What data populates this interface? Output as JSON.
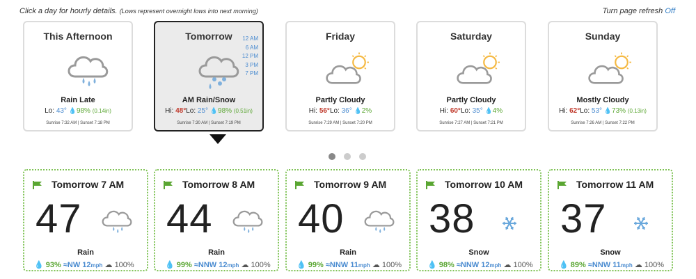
{
  "header": {
    "hint": "Click a day for hourly details.",
    "hint_note": "(Lows represent overnight lows into next morning)",
    "refresh_label": "Turn page refresh",
    "refresh_value": "Off"
  },
  "days": [
    {
      "title": "This Afternoon",
      "icon": "rain-cloud-icon",
      "cond": "Rain Late",
      "hi": "",
      "lo": "43°",
      "pop": "98%",
      "amt": "(0.14in)",
      "sun": "Sunrise 7:32 AM | Sunset 7:18 PM"
    },
    {
      "title": "Tomorrow",
      "icon": "rain-snow-cloud-icon",
      "cond": "AM Rain/Snow",
      "hi": "48°",
      "lo": "25°",
      "pop": "98%",
      "amt": "(0.51in)",
      "sun": "Sunrise 7:30 AM | Sunset 7:19 PM",
      "hours": [
        "12 AM",
        "6 AM",
        "12 PM",
        "3 PM",
        "7 PM"
      ]
    },
    {
      "title": "Friday",
      "icon": "partly-cloudy-icon",
      "cond": "Partly Cloudy",
      "hi": "56°",
      "lo": "36°",
      "pop": "2%",
      "amt": "",
      "sun": "Sunrise 7:29 AM | Sunset 7:20 PM"
    },
    {
      "title": "Saturday",
      "icon": "partly-cloudy-icon",
      "cond": "Partly Cloudy",
      "hi": "60°",
      "lo": "35°",
      "pop": "4%",
      "amt": "",
      "sun": "Sunrise 7:27 AM | Sunset 7:21 PM"
    },
    {
      "title": "Sunday",
      "icon": "mostly-cloudy-icon",
      "cond": "Mostly Cloudy",
      "hi": "62°",
      "lo": "53°",
      "pop": "73%",
      "amt": "(0.13in)",
      "sun": "Sunrise 7:26 AM | Sunset 7:22 PM"
    }
  ],
  "labels": {
    "hi": "Hi:",
    "lo": "Lo:"
  },
  "pager": {
    "count": 3,
    "active": 0
  },
  "hours": [
    {
      "title": "Tomorrow 7 AM",
      "temp": "47",
      "icon": "rain-cloud-icon",
      "cond": "Rain",
      "pop": "93%",
      "wind_dir": "NW",
      "wind_speed": "12",
      "wind_unit": "mph",
      "cloud": "100%"
    },
    {
      "title": "Tomorrow 8 AM",
      "temp": "44",
      "icon": "rain-cloud-icon",
      "cond": "Rain",
      "pop": "99%",
      "wind_dir": "NNW",
      "wind_speed": "12",
      "wind_unit": "mph",
      "cloud": "100%"
    },
    {
      "title": "Tomorrow 9 AM",
      "temp": "40",
      "icon": "rain-cloud-icon",
      "cond": "Rain",
      "pop": "99%",
      "wind_dir": "NNW",
      "wind_speed": "11",
      "wind_unit": "mph",
      "cloud": "100%"
    },
    {
      "title": "Tomorrow 10 AM",
      "temp": "38",
      "icon": "snowflake-icon",
      "cond": "Snow",
      "pop": "98%",
      "wind_dir": "NNW",
      "wind_speed": "12",
      "wind_unit": "mph",
      "cloud": "100%"
    },
    {
      "title": "Tomorrow 11 AM",
      "temp": "37",
      "icon": "snowflake-icon",
      "cond": "Snow",
      "pop": "89%",
      "wind_dir": "NNW",
      "wind_speed": "11",
      "wind_unit": "mph",
      "cloud": "100%"
    }
  ],
  "colors": {
    "hi": "#c0392b",
    "lo": "#4a8bd0",
    "precip": "#5aa632",
    "border_hour": "#7fc255",
    "sun": "#f5b942"
  }
}
